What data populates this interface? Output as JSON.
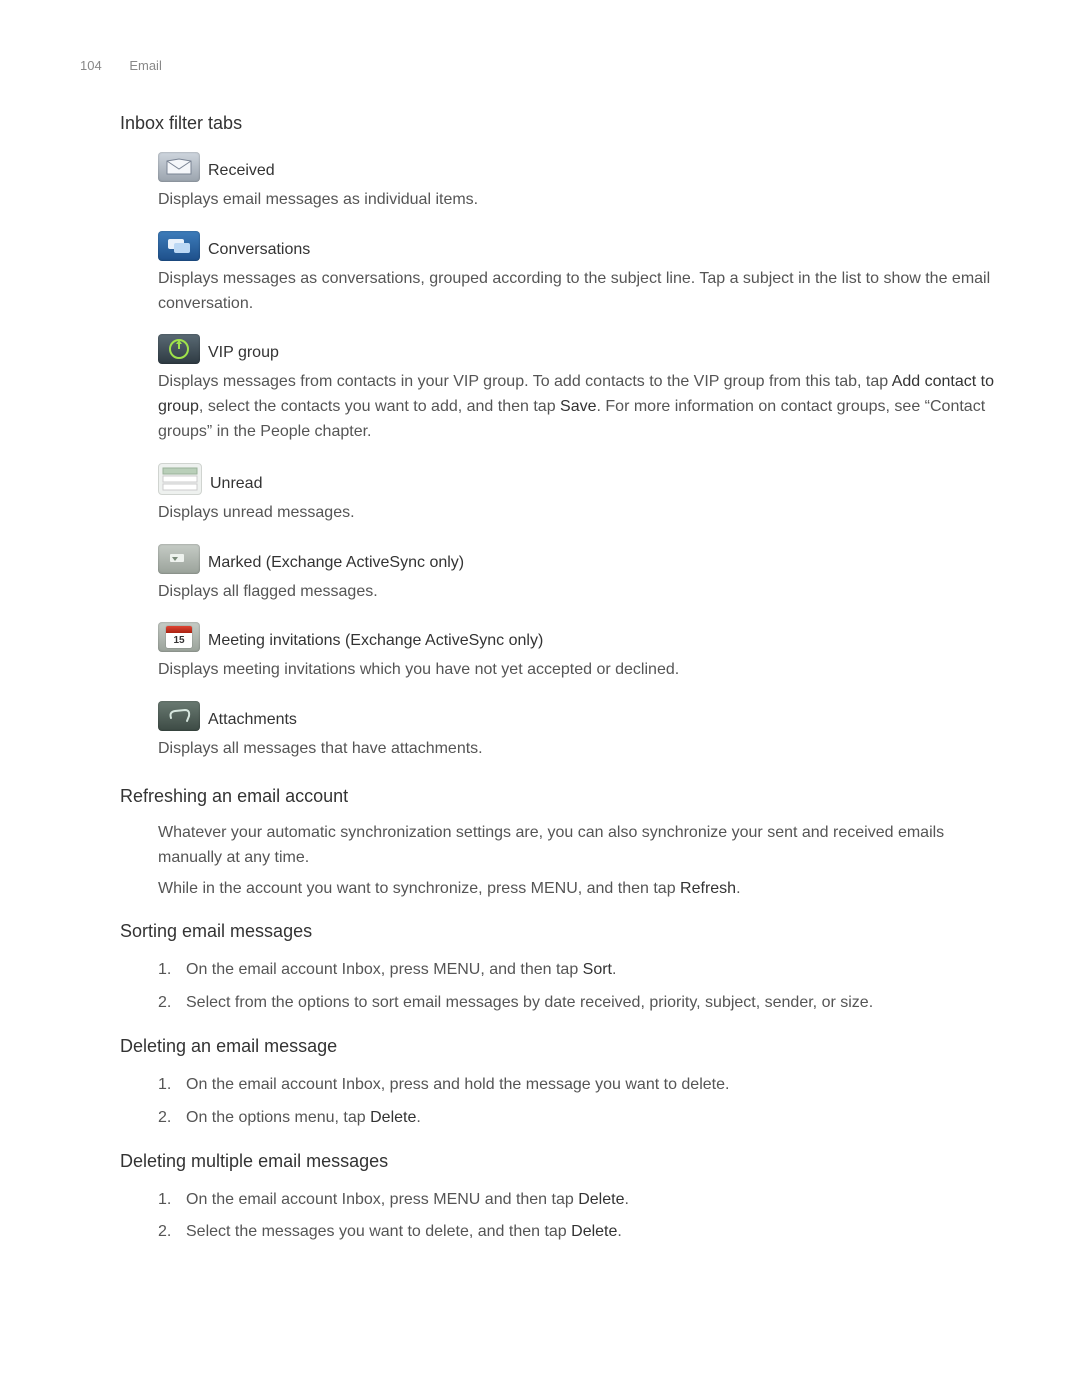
{
  "header": {
    "page_number": "104",
    "section": "Email"
  },
  "h1": "Inbox filter tabs",
  "tabs": [
    {
      "icon": "envelope-icon",
      "label": "Received",
      "desc": "Displays email messages as individual items."
    },
    {
      "icon": "conversations-icon",
      "label": "Conversations",
      "desc": "Displays messages as conversations, grouped according to the subject line. Tap a subject in the list to show the email conversation."
    },
    {
      "icon": "vip-icon",
      "label": "VIP group",
      "desc_pre": "Displays messages from contacts in your VIP group. To add contacts to the VIP group from this tab, tap ",
      "desc_b1": "Add contact to group",
      "desc_mid": ", select the contacts you want to add, and then tap ",
      "desc_b2": "Save",
      "desc_post": ". For more information on contact groups, see “Contact groups” in the People chapter."
    },
    {
      "icon": "unread-icon",
      "label": "Unread",
      "desc": "Displays unread messages."
    },
    {
      "icon": "flag-icon",
      "label": "Marked (Exchange ActiveSync only)",
      "desc": "Displays all flagged messages."
    },
    {
      "icon": "calendar-icon",
      "cal_num": "15",
      "label": "Meeting invitations (Exchange ActiveSync only)",
      "desc": "Displays meeting invitations which you have not yet accepted or declined."
    },
    {
      "icon": "paperclip-icon",
      "label": "Attachments",
      "desc": "Displays all messages that have attachments."
    }
  ],
  "refresh": {
    "heading": "Refreshing an email account",
    "p1": "Whatever your automatic synchronization settings are, you can also synchronize your sent and received emails manually at any time.",
    "p2_pre": "While in the account you want to synchronize, press MENU, and then tap ",
    "p2_b": "Refresh",
    "p2_post": "."
  },
  "sorting": {
    "heading": "Sorting email messages",
    "li1_pre": "On the email account Inbox, press MENU, and then tap ",
    "li1_b": "Sort",
    "li1_post": ".",
    "li2": "Select from the options to sort email messages by date received, priority, subject, sender, or size."
  },
  "deleting_one": {
    "heading": "Deleting an email message",
    "li1": "On the email account Inbox, press and hold the message you want to delete.",
    "li2_pre": "On the options menu, tap ",
    "li2_b": "Delete",
    "li2_post": "."
  },
  "deleting_many": {
    "heading": "Deleting multiple email messages",
    "li1_pre": "On the email account Inbox, press MENU and then tap ",
    "li1_b": "Delete",
    "li1_post": ".",
    "li2_pre": "Select the messages you want to delete, and then tap ",
    "li2_b": "Delete",
    "li2_post": "."
  }
}
